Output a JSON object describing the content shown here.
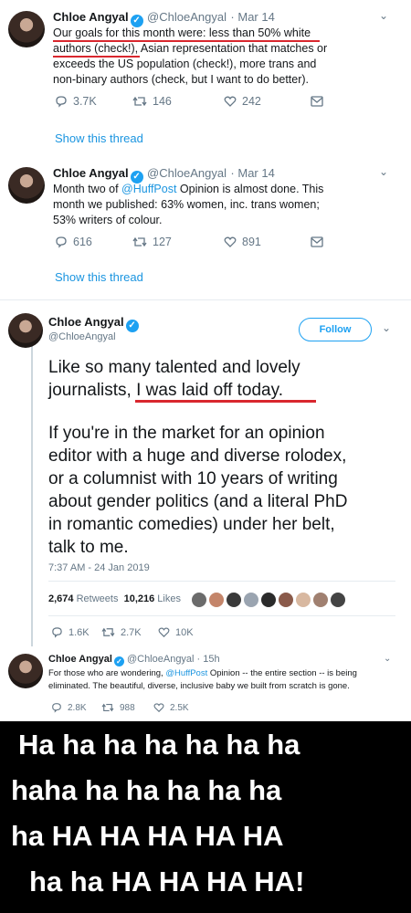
{
  "tweet1": {
    "name": "Chloe Angyal",
    "handle": "@ChloeAngyal",
    "date": "· Mar 14",
    "text_a": "Our goals for this month were: less than 50% white",
    "text_b": "authors (check!), Asian representation that matches or",
    "text_c": "exceeds the US population (check!), more trans and",
    "text_d": "non-binary authors (check, but I want to do better).",
    "replies": "3.7K",
    "retweets": "146",
    "likes": "242",
    "show_thread": "Show this thread"
  },
  "tweet2": {
    "name": "Chloe Angyal",
    "handle": "@ChloeAngyal",
    "date": "· Mar 14",
    "text_a_pre": "Month two of ",
    "text_a_link": "@HuffPost",
    "text_a_post": " Opinion is almost done. This",
    "text_b": "month we published: 63% women, inc. trans women;",
    "text_c": "53% writers of colour.",
    "replies": "616",
    "retweets": "127",
    "likes": "891",
    "show_thread": "Show this thread"
  },
  "tweet3": {
    "name": "Chloe Angyal",
    "handle": "@ChloeAngyal",
    "follow": "Follow",
    "line1": "Like so many talented and lovely",
    "line2": "journalists, I was laid off today.",
    "line3": "If you're in the market for an opinion",
    "line4": "editor with a huge and diverse rolodex,",
    "line5": "or a columnist with 10 years of writing",
    "line6": "about gender politics (and a literal PhD",
    "line7": "in romantic comedies) under her belt,",
    "line8": "talk to me.",
    "timestamp": "7:37 AM - 24 Jan 2019",
    "retweets_count": "2,674",
    "retweets_label": "Retweets",
    "likes_count": "10,216",
    "likes_label": "Likes",
    "replies": "1.6K",
    "retweets": "2.7K",
    "likes": "10K"
  },
  "tweet4": {
    "name": "Chloe Angyal",
    "handle": "@ChloeAngyal · 15h",
    "text_a_pre": "For those who are wondering, ",
    "text_a_link": "@HuffPost",
    "text_a_post": " Opinion -- the entire section -- is being",
    "text_b": "eliminated. The beautiful, diverse, inclusive baby we built from scratch is gone.",
    "replies": "2.8K",
    "retweets": "988",
    "likes": "2.5K"
  },
  "meme": {
    "line1": "Ha ha ha ha ha ha ha",
    "line2": "haha ha ha ha ha ha",
    "line3": "ha HA HA HA HA HA",
    "line4": "ha ha HA HA HA HA!"
  },
  "colors": {
    "accent": "#1da1f2",
    "underline": "#d9272e",
    "meme_bg": "#000000"
  }
}
